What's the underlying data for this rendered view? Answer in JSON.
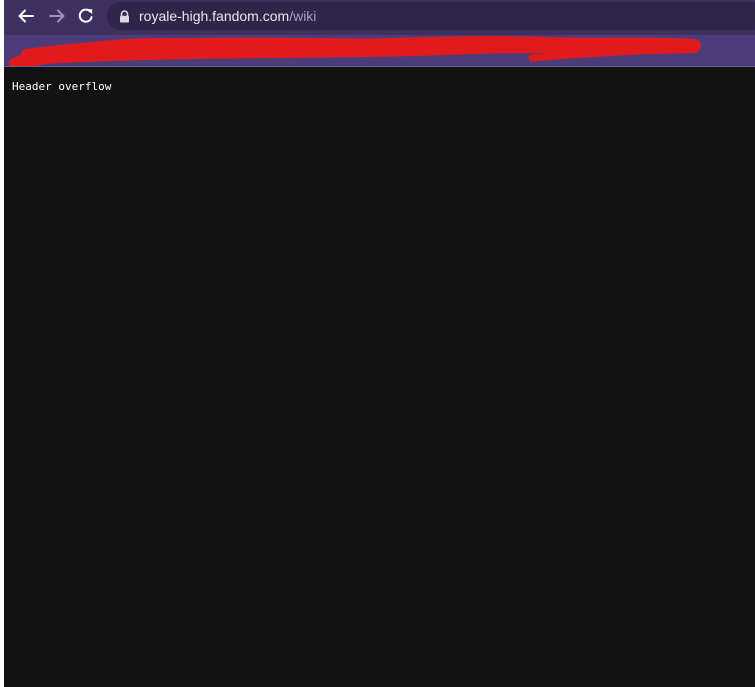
{
  "browser": {
    "nav": {
      "back_icon": "arrow-left-icon",
      "forward_icon": "arrow-right-icon",
      "reload_icon": "reload-icon"
    },
    "address_bar": {
      "lock_icon": "lock-icon",
      "host": "royale-high.fandom.com",
      "path": "/wiki"
    },
    "bookmarks_bar": {
      "redacted": true,
      "redaction_color": "#e11b1b"
    },
    "colors": {
      "chrome_bg": "#3e315f",
      "omnibox_bg": "#2e2549",
      "bookmarks_bg": "#4c3d7a"
    }
  },
  "page": {
    "background": "#121212",
    "text": "Header overflow"
  }
}
